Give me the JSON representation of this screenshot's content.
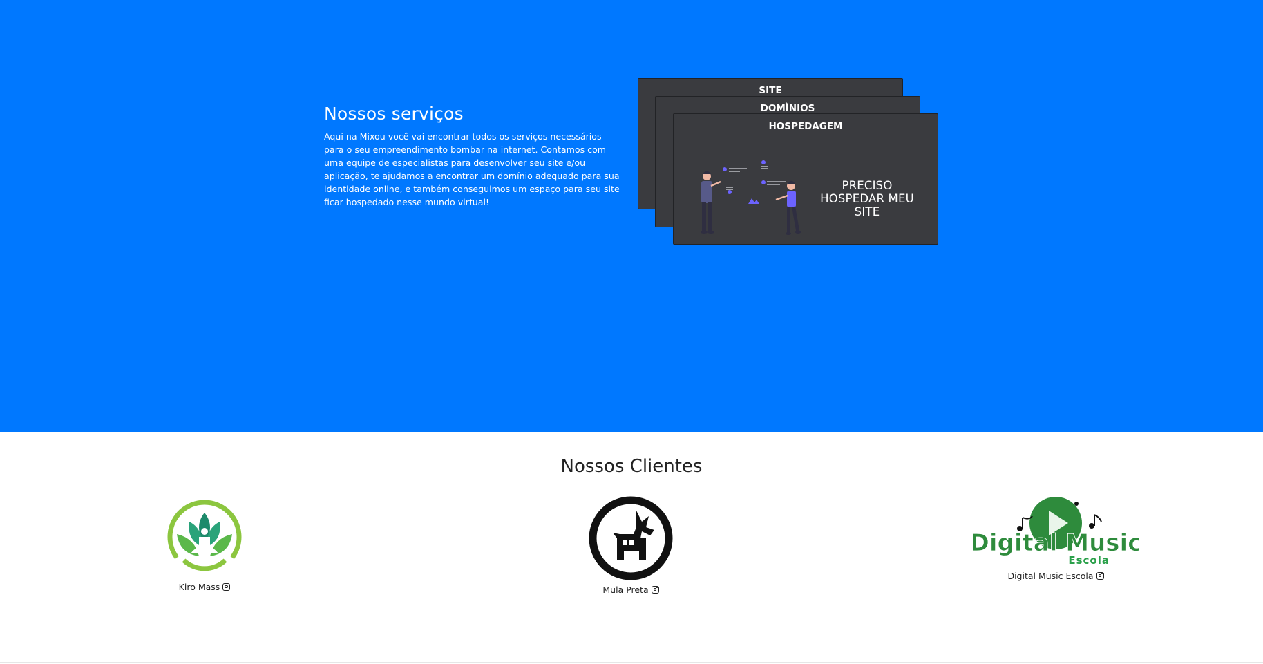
{
  "services": {
    "title": "Nossos serviços",
    "description": "Aqui na Mixou você vai encontrar todos os serviços necessários para o seu empreendimento bombar na internet. Contamos com uma equipe de especialistas para desenvolver seu site e/ou aplicação, te ajudamos a encontrar um domínio adequado para sua identidade online, e também conseguimos um espaço para seu site ficar hospedado nesse mundo virtual!",
    "cards": [
      {
        "label": "SITE"
      },
      {
        "label": "DOMÌNIOS"
      },
      {
        "label": "HOSPEDAGEM",
        "cta": "PRECISO HOSPEDAR MEU SITE"
      }
    ]
  },
  "clients": {
    "title": "Nossos Clientes",
    "items": [
      {
        "name": "Kiro Mass",
        "icon": "instagram-icon"
      },
      {
        "name": "Mula Preta",
        "icon": "instagram-icon"
      },
      {
        "name": "Digital Music Escola",
        "icon": "instagram-icon",
        "logo_text": "Digital Music",
        "logo_subtext": "Escola"
      }
    ]
  },
  "colors": {
    "hero_bg": "#0078FF",
    "card_bg": "#3a3b3f",
    "accent": "#6c63ff",
    "kiro_green": "#8cc63f",
    "music_green": "#2e8b3c"
  }
}
